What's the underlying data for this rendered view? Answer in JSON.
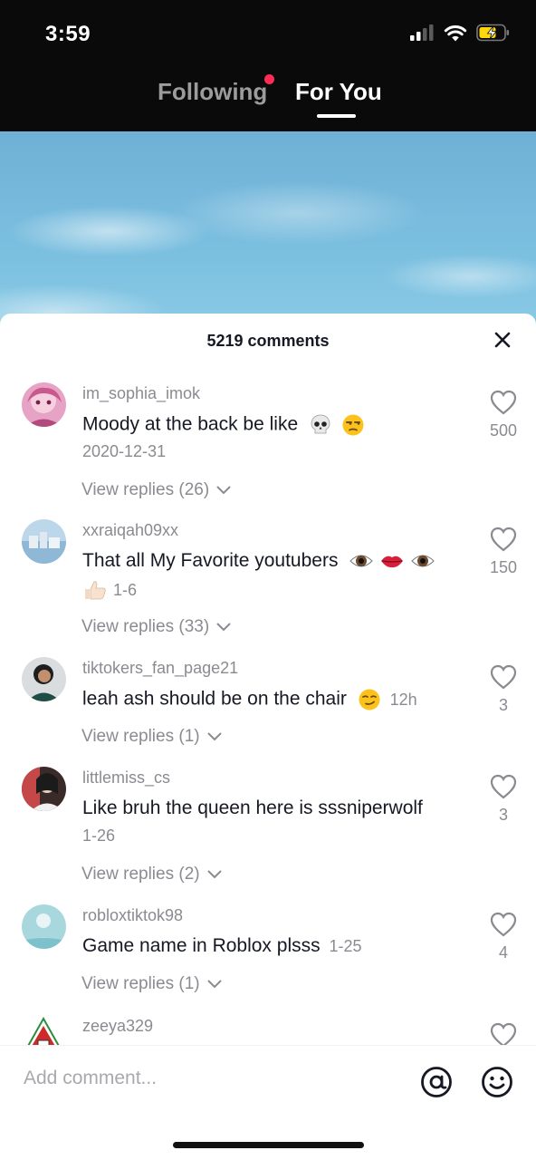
{
  "status_bar": {
    "time": "3:59"
  },
  "feed_tabs": {
    "following": "Following",
    "for_you": "For You"
  },
  "comments_sheet": {
    "title": "5219 comments",
    "comments": [
      {
        "username": "im_sophia_imok",
        "text": "Moody at the back be like",
        "date": "2020-12-31",
        "replies": "View replies (26)",
        "likes": "500"
      },
      {
        "username": "xxraiqah09xx",
        "text": "That all My Favorite youtubers",
        "date": "1-6",
        "replies": "View replies (33)",
        "likes": "150"
      },
      {
        "username": "tiktokers_fan_page21",
        "text": "leah ash should be on the chair",
        "date": "12h",
        "replies": "View replies (1)",
        "likes": "3"
      },
      {
        "username": "littlemiss_cs",
        "text": "Like bruh the queen here is sssniperwolf",
        "date": "1-26",
        "replies": "View replies (2)",
        "likes": "3"
      },
      {
        "username": "robloxtiktok98",
        "text": "Game name in Roblox plsss",
        "date": "1-25",
        "replies": "View replies (1)",
        "likes": "4"
      },
      {
        "username": "zeeya329"
      }
    ]
  },
  "comment_bar": {
    "placeholder": "Add comment..."
  },
  "icons": {
    "signal": "signal-icon",
    "wifi": "wifi-icon",
    "battery": "battery-charging-icon",
    "close": "close-icon",
    "heart": "heart-outline-icon",
    "chevron": "chevron-down-icon",
    "mention": "at-sign-icon",
    "emoji": "emoji-smile-icon"
  },
  "colors": {
    "accent": "#fe2c55",
    "secondary_text": "#8a8b91",
    "battery": "#ffd60a"
  }
}
